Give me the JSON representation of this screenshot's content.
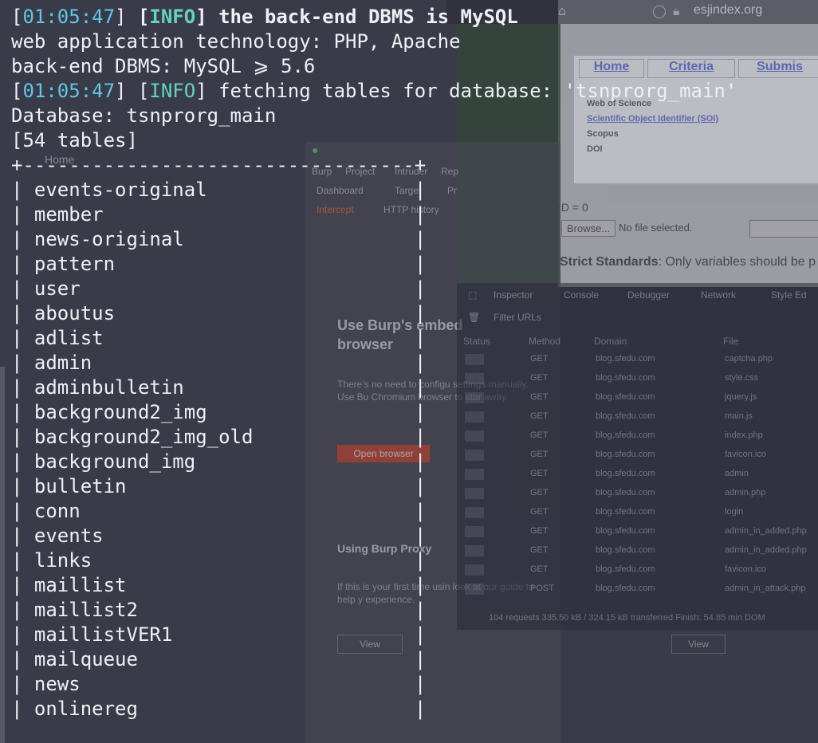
{
  "background": {
    "browser_url": "esjindex.org",
    "site_nav": [
      "Home",
      "Criteria",
      "Submis"
    ],
    "site_links": [
      "Web of Science",
      "Scientific Object Identifier (SOI)",
      "Scopus",
      "DOI"
    ],
    "site_text": {
      "id_line": "ID = 0",
      "browse_button": "Browse...",
      "no_file": "No file selected.",
      "strict_label": "Strict Standards",
      "strict_msg": ": Only variables should be p"
    },
    "burp": {
      "menu": [
        "Burp",
        "Project",
        "Intruder",
        "Rep"
      ],
      "tabs": [
        "Dashboard",
        "Target",
        "Pr"
      ],
      "subtabs": [
        "Intercept",
        "HTTP history"
      ],
      "heading1": "Use Burp's embed",
      "heading1b": "browser",
      "para1": "There's no need to configu settings manually. Use Bu Chromium browser to star away.",
      "open_button": "Open browser",
      "heading2": "Using Burp Proxy",
      "para2": "If this is your first time usin look at our guide to help y experience.",
      "view_button": "View",
      "side_home": "Home"
    },
    "devtools": {
      "tabs": [
        "Inspector",
        "Console",
        "Debugger",
        "Network",
        "Style Ed"
      ],
      "filter": "Filter URLs",
      "columns": [
        "Status",
        "Method",
        "Domain",
        "File"
      ],
      "rows": [
        {
          "method": "GET",
          "domain": "blog.sfedu.com",
          "file": "captcha.php"
        },
        {
          "method": "GET",
          "domain": "blog.sfedu.com",
          "file": "style.css"
        },
        {
          "method": "GET",
          "domain": "blog.sfedu.com",
          "file": "jquery.js"
        },
        {
          "method": "GET",
          "domain": "blog.sfedu.com",
          "file": "main.js"
        },
        {
          "method": "GET",
          "domain": "blog.sfedu.com",
          "file": "index.php"
        },
        {
          "method": "GET",
          "domain": "blog.sfedu.com",
          "file": "favicon.ico"
        },
        {
          "method": "GET",
          "domain": "blog.sfedu.com",
          "file": "admin"
        },
        {
          "method": "GET",
          "domain": "blog.sfedu.com",
          "file": "admin.php"
        },
        {
          "method": "GET",
          "domain": "blog.sfedu.com",
          "file": "login"
        },
        {
          "method": "GET",
          "domain": "blog.sfedu.com",
          "file": "admin_in_added.php"
        },
        {
          "method": "GET",
          "domain": "blog.sfedu.com",
          "file": "admin_in_added.php"
        },
        {
          "method": "GET",
          "domain": "blog.sfedu.com",
          "file": "favicon.ico"
        },
        {
          "method": "POST",
          "domain": "blog.sfedu.com",
          "file": "admin_in_attack.php"
        }
      ],
      "footer": "104 requests   335.50 kB / 324.15 kB transferred   Finish: 54.85 min   DOM"
    },
    "view_button2": "View"
  },
  "terminal": {
    "line1": {
      "time": "01:05:47",
      "level": "INFO",
      "msg": " the back-end DBMS is MySQL"
    },
    "line2": "web application technology: PHP, Apache",
    "line3": "back-end DBMS: MySQL ⩾ 5.6",
    "line4": {
      "time": "01:05:47",
      "level": "INFO",
      "msg": " fetching tables for database: 'tsnprorg_main'"
    },
    "line5": "Database: tsnprorg_main",
    "line6": "[54 tables]",
    "table_border": "+----------------------------------+",
    "tables": [
      "events-original",
      "member",
      "news-original",
      "pattern",
      "user",
      "aboutus",
      "adlist",
      "admin",
      "adminbulletin",
      "background2_img",
      "background2_img_old",
      "background_img",
      "bulletin",
      "conn",
      "events",
      "links",
      "maillist",
      "maillist2",
      "maillistVER1",
      "mailqueue",
      "news",
      "onlinereg"
    ]
  }
}
